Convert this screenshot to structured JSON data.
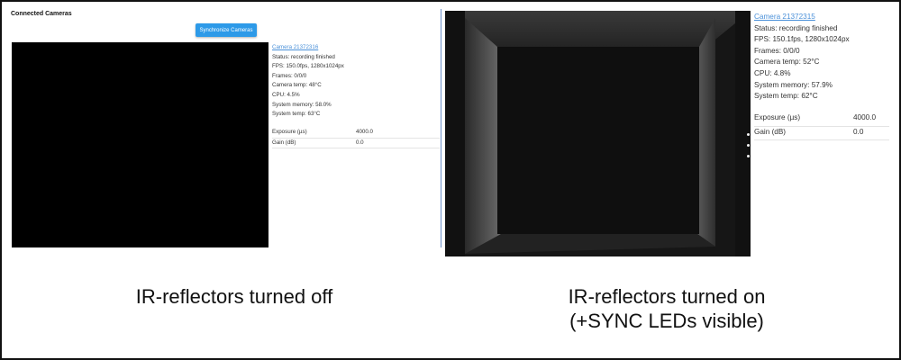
{
  "left_panel": {
    "title": "Connected Cameras",
    "sync_button": "Synchronize Cameras",
    "camera_link": "Camera 21372316",
    "status": "Status: recording finished",
    "fps": "FPS: 150.0fps, 1280x1024px",
    "frames": "Frames: 0/0/0",
    "camera_temp": "Camera temp: 48°C",
    "cpu": "CPU: 4.5%",
    "system_memory": "System memory: 58.0%",
    "system_temp": "System temp: 63°C",
    "params": [
      {
        "label": "Exposure (µs)",
        "value": "4000.0"
      },
      {
        "label": "Gain (dB)",
        "value": "0.0"
      }
    ]
  },
  "right_panel": {
    "camera_link": "Camera 21372315",
    "status": "Status: recording finished",
    "fps": "FPS: 150.1fps, 1280x1024px",
    "frames": "Frames: 0/0/0",
    "camera_temp": "Camera temp: 52°C",
    "cpu": "CPU: 4.8%",
    "system_memory": "System memory: 57.9%",
    "system_temp": "System temp: 62°C",
    "params": [
      {
        "label": "Exposure (µs)",
        "value": "4000.0"
      },
      {
        "label": "Gain (dB)",
        "value": "0.0"
      }
    ]
  },
  "captions": {
    "left": "IR-reflectors turned off",
    "right_line1": "IR-reflectors turned on",
    "right_line2": "(+SYNC LEDs visible)"
  }
}
